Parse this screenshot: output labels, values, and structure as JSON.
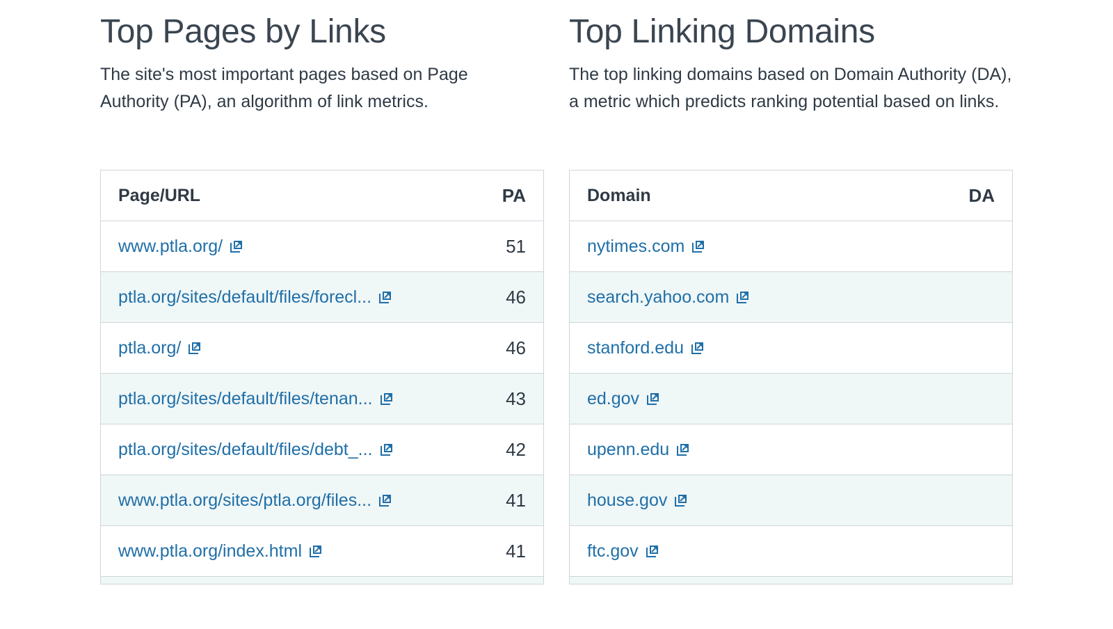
{
  "left_panel": {
    "title": "Top Pages by Links",
    "description": "The site's most important pages based on Page Authority (PA), an algorithm of link metrics.",
    "col_main": "Page/URL",
    "col_metric": "PA",
    "rows": [
      {
        "url": "www.ptla.org/",
        "value": "51"
      },
      {
        "url": "ptla.org/sites/default/files/forecl...",
        "value": "46"
      },
      {
        "url": "ptla.org/",
        "value": "46"
      },
      {
        "url": "ptla.org/sites/default/files/tenan...",
        "value": "43"
      },
      {
        "url": "ptla.org/sites/default/files/debt_...",
        "value": "42"
      },
      {
        "url": "www.ptla.org/sites/ptla.org/files...",
        "value": "41"
      },
      {
        "url": "www.ptla.org/index.html",
        "value": "41"
      }
    ]
  },
  "right_panel": {
    "title": "Top Linking Domains",
    "description": "The top linking domains based on Domain Authority (DA), a metric which predicts ranking potential based on links.",
    "col_main": "Domain",
    "col_metric": "DA",
    "rows": [
      {
        "url": "nytimes.com",
        "value": ""
      },
      {
        "url": "search.yahoo.com",
        "value": ""
      },
      {
        "url": "stanford.edu",
        "value": ""
      },
      {
        "url": "ed.gov",
        "value": ""
      },
      {
        "url": "upenn.edu",
        "value": ""
      },
      {
        "url": "house.gov",
        "value": ""
      },
      {
        "url": "ftc.gov",
        "value": ""
      }
    ]
  },
  "icons": {
    "external_link": "external-link-icon"
  },
  "colors": {
    "link": "#1f6fa8",
    "alt_row": "#f0f7f7",
    "border": "#cfd5d9",
    "text": "#2f3a45"
  }
}
